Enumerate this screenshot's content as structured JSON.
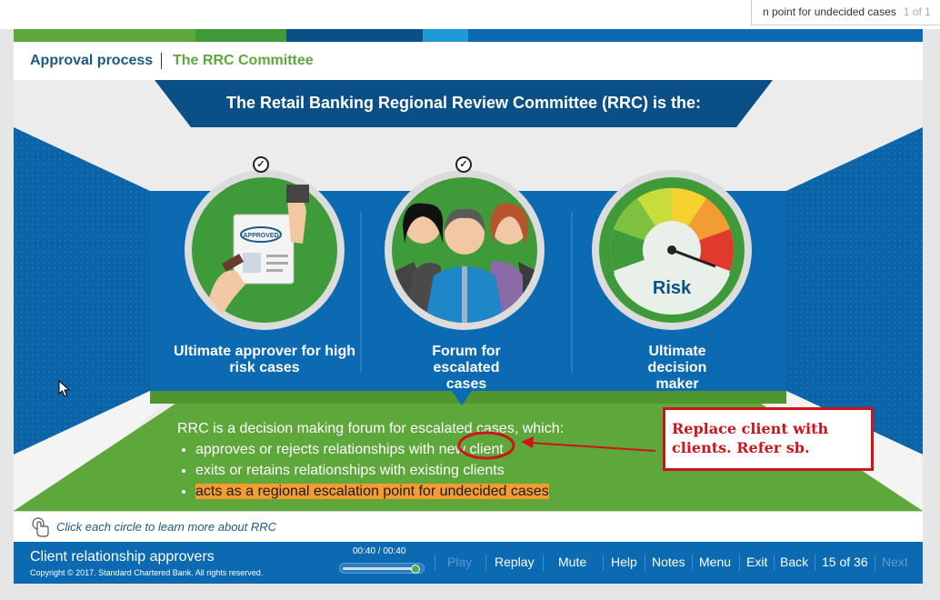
{
  "find_bar": {
    "query": "n point for undecided cases",
    "count": "1 of 1"
  },
  "colors": {
    "blue": "#0c6ab2",
    "dark_blue": "#0b4f87",
    "green": "#5ea83b",
    "annotation_red": "#d0121a",
    "highlight": "#f39c34"
  },
  "breadcrumb": {
    "section": "Approval process",
    "page": "The RRC Committee"
  },
  "slide": {
    "title": "The Retail Banking Regional Review Committee (RRC) is the:",
    "roles": [
      {
        "label": "Ultimate approver for high risk cases",
        "icon": "approved-stamp-icon",
        "visited": true
      },
      {
        "label": "Forum for escalated cases",
        "icon": "people-group-icon",
        "visited": true
      },
      {
        "label": "Ultimate decision maker",
        "icon": "risk-gauge-icon",
        "visited": false,
        "icon_text": "Risk"
      }
    ],
    "summary_intro": "RRC is a decision making forum for escalated cases, which:",
    "bullets": [
      "approves or rejects relationships with new client",
      "exits or retains relationships with existing clients",
      "acts as a regional escalation point for undecided cases"
    ]
  },
  "annotation": {
    "text": "Replace client with clients. Refer sb."
  },
  "hint": {
    "text": "Click each circle to learn more about RRC",
    "icon": "touch-hand-icon"
  },
  "footer": {
    "course_title": "Client relationship approvers",
    "copyright": "Copyright © 2017. Standard Chartered Bank. All rights reserved.",
    "time": "00:40 / 00:40",
    "progress": 1.0,
    "buttons": {
      "play": "Play",
      "replay": "Replay",
      "mute": "Mute",
      "help": "Help",
      "notes": "Notes",
      "menu": "Menu",
      "exit": "Exit",
      "back": "Back",
      "next": "Next"
    },
    "page_indicator": "15 of 36"
  }
}
